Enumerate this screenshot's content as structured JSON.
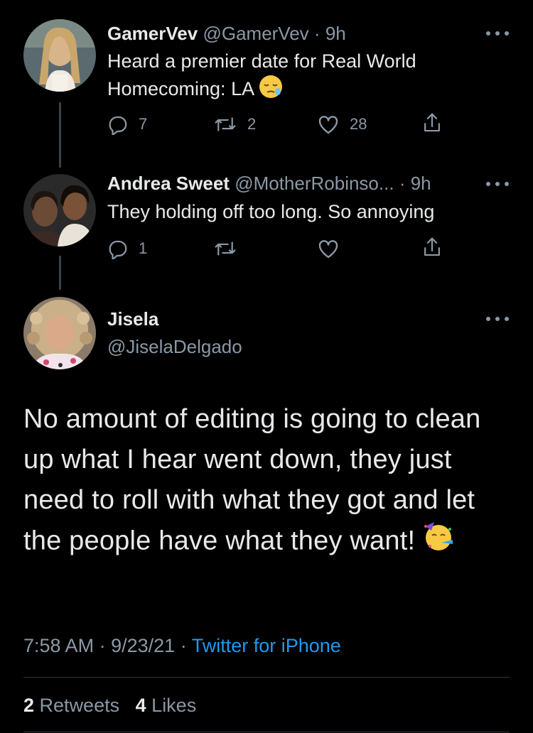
{
  "thread": [
    {
      "name": "GamerVev",
      "handle": "@GamerVev",
      "dot": "·",
      "time": "9h",
      "text": "Heard a premier date for Real World Homecoming: LA",
      "emoji": "sleepy-face",
      "replies": "7",
      "retweets": "2",
      "likes": "28"
    },
    {
      "name": "Andrea Sweet",
      "handle": "@MotherRobinso...",
      "dot": "·",
      "time": "9h",
      "text": "They holding off too long. So annoying",
      "replies": "1",
      "retweets": "",
      "likes": ""
    }
  ],
  "main_tweet": {
    "name": "Jisela",
    "handle": "@JiselaDelgado",
    "text": "No amount of editing is going to clean up what I hear went down, they just need to roll with what they got and let the people have what they want!",
    "emoji": "partying-face",
    "time": "7:58 AM",
    "sep1": "·",
    "date": "9/23/21",
    "sep2": "·",
    "source": "Twitter for iPhone",
    "retweets_count": "2",
    "retweets_label": "Retweets",
    "likes_count": "4",
    "likes_label": "Likes"
  },
  "colors": {
    "background": "#000000",
    "text": "#e7e9ea",
    "muted": "#8b98a5",
    "accent": "#1d9bf0",
    "divider": "#2f3336"
  }
}
